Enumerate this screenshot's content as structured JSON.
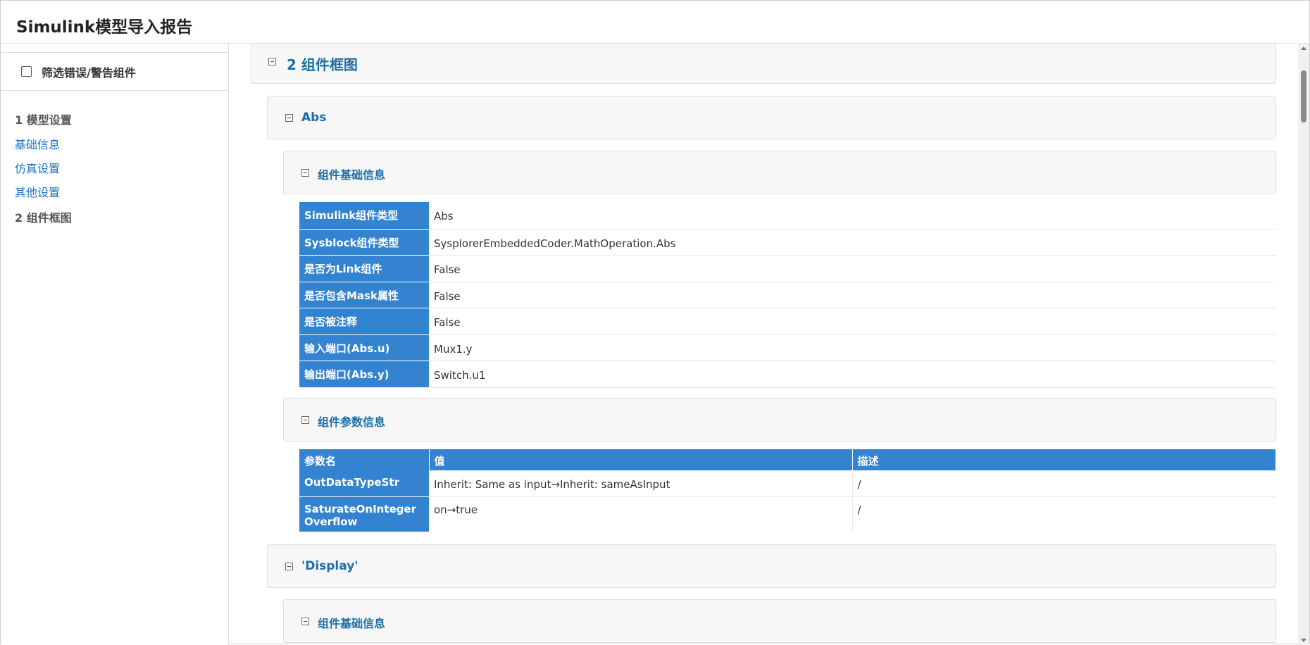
{
  "header": {
    "title": "Simulink模型导入报告"
  },
  "sidebar": {
    "filter_label": "筛选错误/警告组件",
    "toc": [
      {
        "label": "1 模型设置",
        "type": "heading"
      },
      {
        "label": "基础信息",
        "type": "link"
      },
      {
        "label": "仿真设置",
        "type": "link"
      },
      {
        "label": "其他设置",
        "type": "link"
      },
      {
        "label": "2 组件框图",
        "type": "heading"
      }
    ]
  },
  "main": {
    "section_title": "2 组件框图",
    "abs": {
      "title": "Abs",
      "basic_title": "组件基础信息",
      "basic_rows": [
        {
          "key": "Simulink组件类型",
          "value": "Abs"
        },
        {
          "key": "Sysblock组件类型",
          "value": "SysplorerEmbeddedCoder.MathOperation.Abs"
        },
        {
          "key": "是否为Link组件",
          "value": "False"
        },
        {
          "key": "是否包含Mask属性",
          "value": "False"
        },
        {
          "key": "是否被注释",
          "value": "False"
        },
        {
          "key": "输入端口(Abs.u)",
          "value": "Mux1.y"
        },
        {
          "key": "输出端口(Abs.y)",
          "value": "Switch.u1"
        }
      ],
      "param_title": "组件参数信息",
      "param_headers": [
        "参数名",
        "值",
        "描述"
      ],
      "param_rows": [
        {
          "name": "OutDataTypeStr",
          "value": "Inherit: Same as input→Inherit: sameAsInput",
          "desc": "/"
        },
        {
          "name": "SaturateOnIntegerOverflow",
          "value": "on→true",
          "desc": "/"
        }
      ]
    },
    "display": {
      "title": "'Display'",
      "basic_title": "组件基础信息"
    }
  }
}
